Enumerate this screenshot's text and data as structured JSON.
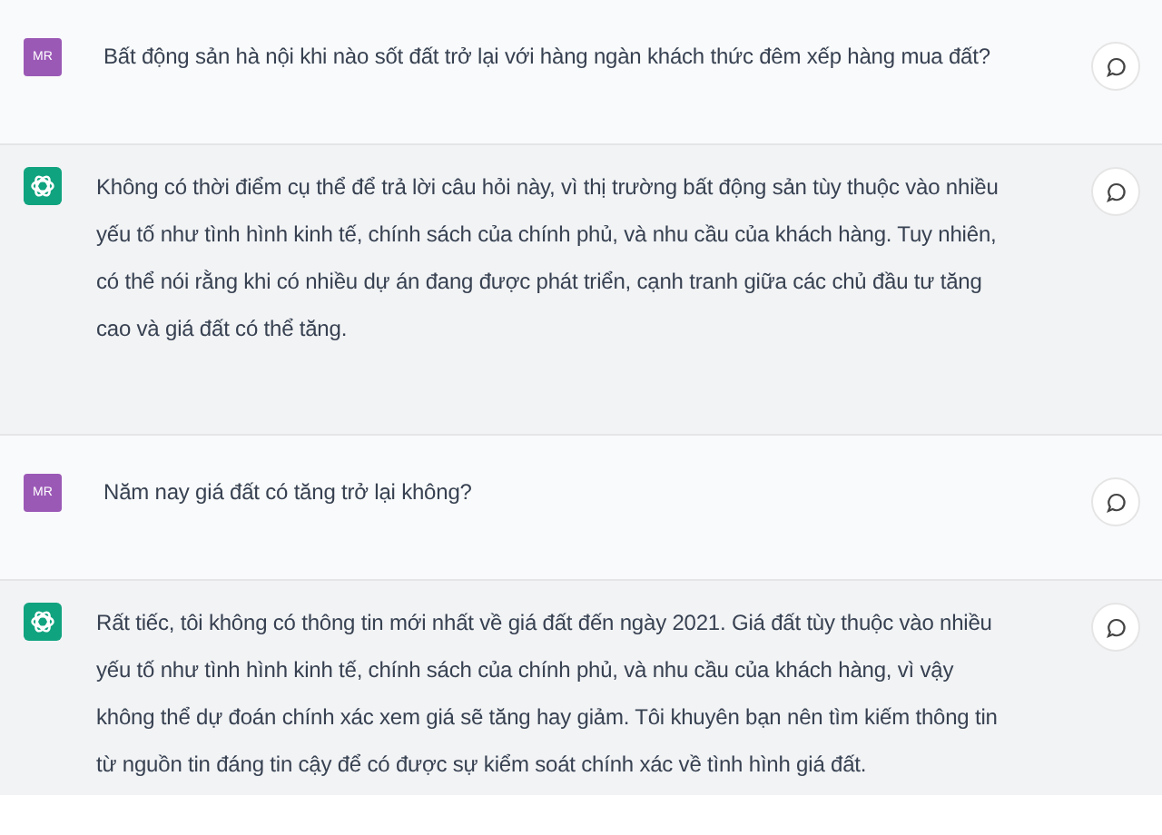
{
  "messages": [
    {
      "kind": "user",
      "avatar": "MR",
      "text": "Bất động sản hà nội khi nào sốt đất trở lại với hàng ngàn khách thức đêm xếp hàng mua đất?"
    },
    {
      "kind": "assistant",
      "text": "Không có thời điểm cụ thể để trả lời câu hỏi này, vì thị trường bất động sản tùy thuộc vào nhiều yếu tố như tình hình kinh tế, chính sách của chính phủ, và nhu cầu của khách hàng. Tuy nhiên, có thể nói rằng khi có nhiều dự án đang được phát triển, cạnh tranh giữa các chủ đầu tư tăng cao và giá đất có thể tăng."
    },
    {
      "kind": "user",
      "avatar": "MR",
      "text": "Năm nay giá đất có tăng trở lại không?"
    },
    {
      "kind": "assistant",
      "text": "Rất tiếc, tôi không có thông tin mới nhất về giá đất đến ngày 2021. Giá đất tùy thuộc vào nhiều yếu tố như tình hình kinh tế, chính sách của chính phủ, và nhu cầu của khách hàng, vì vậy không thể dự đoán chính xác xem giá sẽ tăng hay giảm. Tôi khuyên bạn nên tìm kiếm thông tin từ nguồn tin đáng tin cậy để có được sự kiểm soát chính xác về tình hình giá đất."
    }
  ]
}
